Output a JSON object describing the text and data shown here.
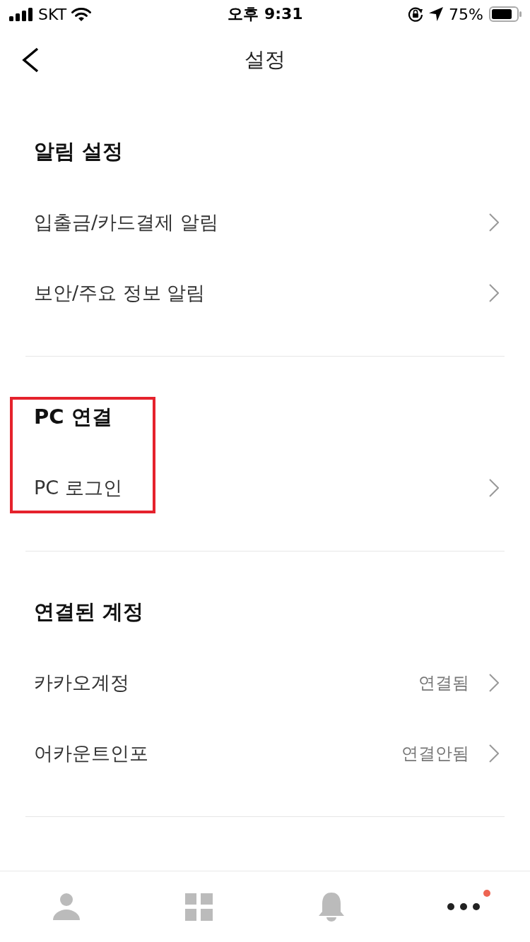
{
  "status_bar": {
    "carrier": "SKT",
    "time": "오후 9:31",
    "battery_percent": "75%"
  },
  "header": {
    "title": "설정"
  },
  "sections": [
    {
      "title": "알림 설정",
      "highlighted": false,
      "items": [
        {
          "label": "입출금/카드결제 알림"
        },
        {
          "label": "보안/주요 정보 알림"
        }
      ]
    },
    {
      "title": "PC 연결",
      "highlighted": true,
      "items": [
        {
          "label": "PC 로그인"
        }
      ]
    },
    {
      "title": "연결된 계정",
      "highlighted": false,
      "items": [
        {
          "label": "카카오계정",
          "value": "연결됨"
        },
        {
          "label": "어카운트인포",
          "value": "연결안됨"
        }
      ]
    }
  ],
  "tab_bar": [
    {
      "kind": "person",
      "selected": false,
      "badge": false
    },
    {
      "kind": "grid",
      "selected": false,
      "badge": false
    },
    {
      "kind": "bell",
      "selected": false,
      "badge": false
    },
    {
      "kind": "more",
      "selected": true,
      "badge": true
    }
  ]
}
